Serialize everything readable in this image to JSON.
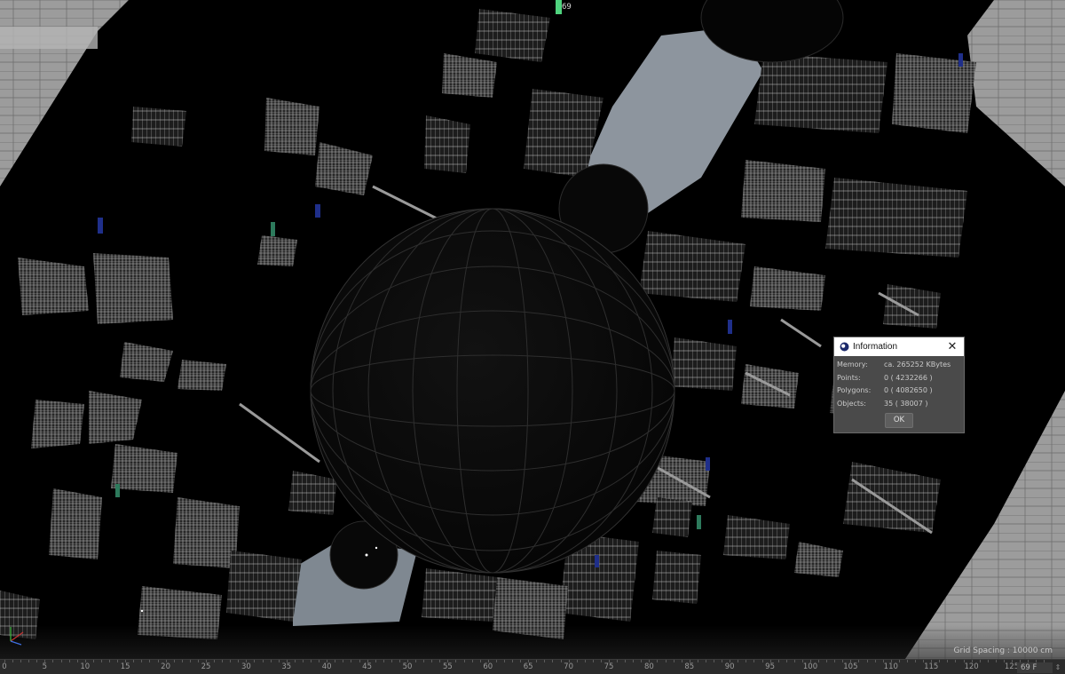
{
  "dialog": {
    "title": "Information",
    "close_icon": "close-icon",
    "app_icon": "cinema4d-logo-icon",
    "rows": [
      {
        "key": "Memory:",
        "value": "ca. 265252 KBytes"
      },
      {
        "key": "Points:",
        "value": "0 ( 4232266 )"
      },
      {
        "key": "Polygons:",
        "value": "0 ( 4082650 )"
      },
      {
        "key": "Objects:",
        "value": "35 ( 38007 )"
      }
    ],
    "ok_label": "OK"
  },
  "viewport": {
    "grid_spacing": "Grid Spacing : 10000 cm",
    "background_color": "#000000",
    "sky_color": "#8d959e"
  },
  "timeline": {
    "ticks": [
      "0",
      "5",
      "10",
      "15",
      "20",
      "25",
      "30",
      "35",
      "40",
      "45",
      "50",
      "55",
      "60",
      "65",
      "70",
      "75",
      "80",
      "85",
      "90",
      "95",
      "100",
      "105",
      "110",
      "115",
      "120",
      "125"
    ],
    "current_frame": "69",
    "playhead_color": "#4fd37e",
    "frame_field": "69 F",
    "stepper_icon": "up-down-arrows-icon"
  }
}
